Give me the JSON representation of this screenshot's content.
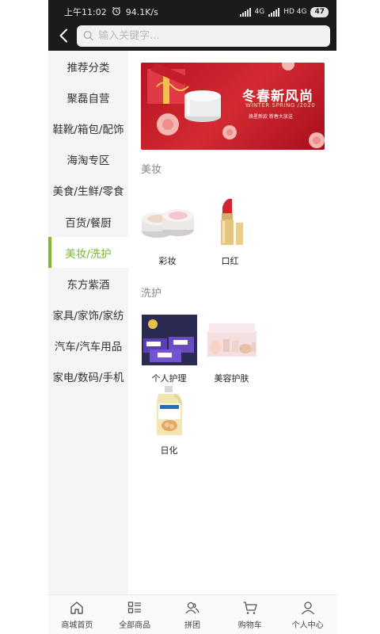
{
  "status_bar": {
    "time": "上午11:02",
    "speed": "94.1K/s",
    "network1": "4G",
    "network2": "HD 4G",
    "battery": "47"
  },
  "search": {
    "placeholder": "输入关键字..."
  },
  "sidebar": {
    "active_index": 6,
    "items": [
      {
        "label": "推荐分类"
      },
      {
        "label": "聚磊自营"
      },
      {
        "label": "鞋靴/箱包/配饰"
      },
      {
        "label": "海淘专区"
      },
      {
        "label": "美食/生鲜/零食"
      },
      {
        "label": "百货/餐厨"
      },
      {
        "label": "美妆/洗护"
      },
      {
        "label": "东方紫酒"
      },
      {
        "label": "家具/家饰/家纺"
      },
      {
        "label": "汽车/汽车用品"
      },
      {
        "label": "家电/数码/手机"
      }
    ]
  },
  "banner": {
    "title": "冬春新风尚",
    "subtitle": "WINTER SPRING /2020",
    "tagline": "焕星新款 新春大放送"
  },
  "sections": [
    {
      "title": "美妆",
      "items": [
        {
          "label": "彩妆",
          "icon": "cushion-compact-icon"
        },
        {
          "label": "口红",
          "icon": "lipstick-icon"
        }
      ]
    },
    {
      "title": "洗护",
      "items": [
        {
          "label": "个人护理",
          "icon": "sanitary-pad-pack-icon"
        },
        {
          "label": "美容护肤",
          "icon": "skincare-set-icon"
        },
        {
          "label": "日化",
          "icon": "detergent-bottle-icon"
        }
      ]
    }
  ],
  "tabbar": [
    {
      "label": "商城首页",
      "icon": "home-icon"
    },
    {
      "label": "全部商品",
      "icon": "category-list-icon"
    },
    {
      "label": "拼团",
      "icon": "group-buy-icon"
    },
    {
      "label": "购物车",
      "icon": "cart-icon"
    },
    {
      "label": "个人中心",
      "icon": "user-icon"
    }
  ],
  "colors": {
    "accent": "#7cba2e",
    "header_bg": "#1b1b1b",
    "sidebar_bg": "#f5f5f5",
    "banner_red": "#c21d28"
  }
}
